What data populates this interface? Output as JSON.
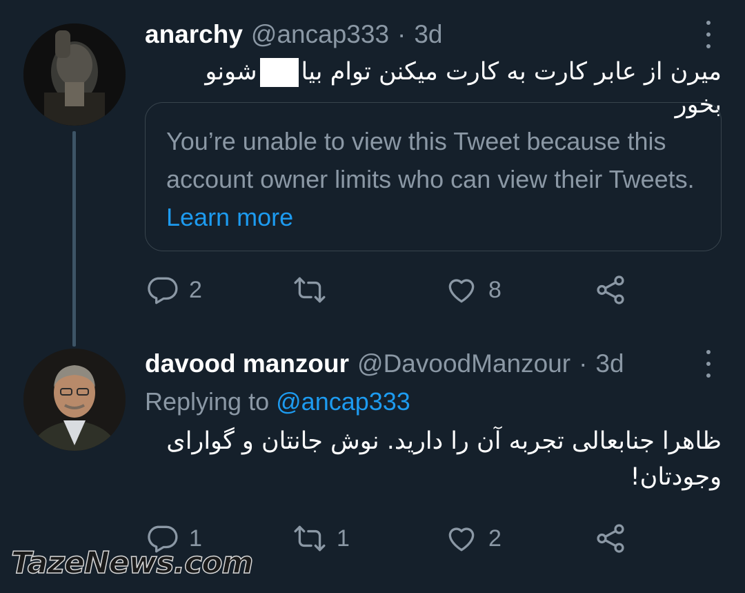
{
  "tweets": [
    {
      "name": "anarchy",
      "handle": "@ancap333",
      "separator": "·",
      "time": "3d",
      "text_before_redaction": "میرن از عابر کارت به کارت میکنن توام بیا",
      "text_after_redaction": "شونو بخور",
      "embed": {
        "message": "You’re unable to view this Tweet because this account owner limits who can view their Tweets.",
        "link": "Learn more"
      },
      "counts": {
        "reply": "2",
        "retweet": "",
        "like": "8"
      }
    },
    {
      "name": "davood manzour",
      "handle": "@DavoodManzour",
      "separator": "·",
      "time": "3d",
      "replying_prefix": "Replying to",
      "replying_to": "@ancap333",
      "text": "ظاهرا جنابعالی تجربه آن را دارید. نوش جانتان و گوارای وجودتان!",
      "counts": {
        "reply": "1",
        "retweet": "1",
        "like": "2"
      }
    }
  ],
  "watermark": "TazeNews.com",
  "colors": {
    "background": "#15202b",
    "secondary_text": "#8b98a5",
    "link": "#1d9bf0",
    "border": "#38444d"
  },
  "icons": [
    "more-icon",
    "reply-icon",
    "retweet-icon",
    "like-icon",
    "share-icon"
  ]
}
